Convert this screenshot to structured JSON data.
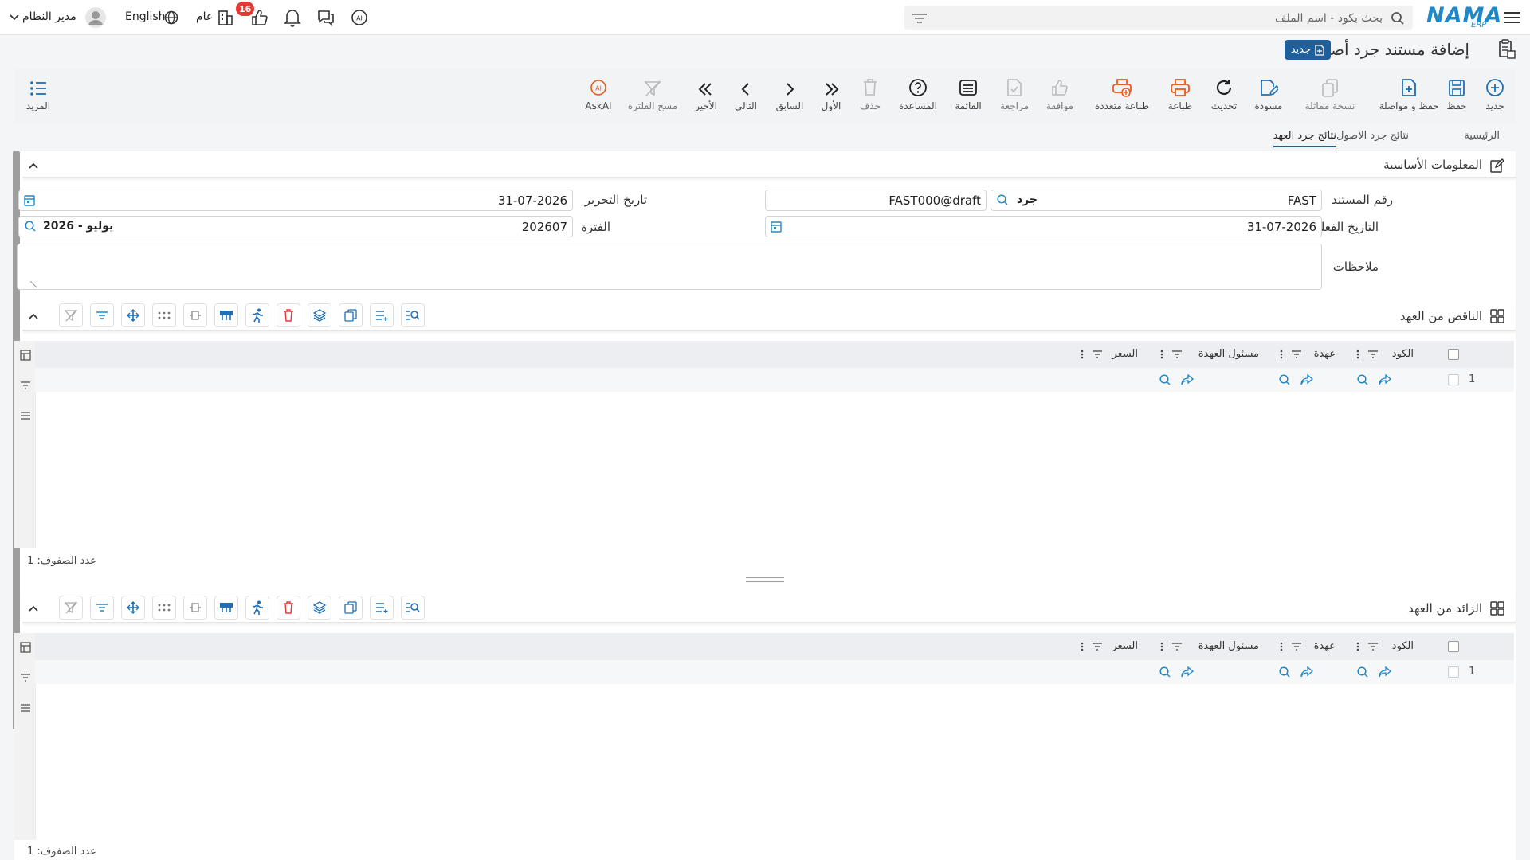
{
  "header": {
    "search_placeholder": "بحث بكود - اسم الملف",
    "logo_text": "NAMA",
    "logo_sub": "ERP",
    "notif_count": "16",
    "general_label": "عام",
    "language_label": "English",
    "user_label": "مدير النظام"
  },
  "page": {
    "title": "إضافة مستند جرد أصول",
    "status_badge": "جديد"
  },
  "toolbar": {
    "new": "جديد",
    "save": "حفظ",
    "save_continue": "حفظ و مواصلة",
    "duplicate": "نسخة مماثلة",
    "draft": "مسودة",
    "refresh": "تحديث",
    "print": "طباعة",
    "multi_print": "طباعة متعددة",
    "approve": "موافقة",
    "review": "مراجعة",
    "list": "القائمة",
    "help": "المساعدة",
    "delete": "حذف",
    "first": "الأول",
    "previous": "السابق",
    "next": "التالي",
    "last": "الأخير",
    "clear_filter": "مسح الفلترة",
    "askai": "AskAI",
    "more": "المزيد"
  },
  "tabs": [
    "الرئيسية",
    "نتائج جرد الاصول",
    "نتائج جرد العهد"
  ],
  "basic_info": {
    "section_title": "المعلومات الأساسية",
    "doc_number_label": "رقم المستند",
    "doc_number_value": "FAST",
    "doc_type_value": "جرد",
    "doc_code_value": "FAST000@draft",
    "edit_date_label": "تاريخ التحرير",
    "edit_date_value": "31-07-2026",
    "actual_date_label": "التاريخ الفعلي",
    "actual_date_value": "31-07-2026",
    "period_label": "الفترة",
    "period_value": "202607",
    "period_name": "2026 - يوليو",
    "notes_label": "ملاحظات"
  },
  "grid1": {
    "title": "الناقص من العهد",
    "columns": [
      "الكود",
      "عهدة",
      "مسئول العهدة",
      "السعر"
    ],
    "row_number": "1",
    "footer": "عدد الصفوف: 1"
  },
  "grid2": {
    "title": "الزائد من العهد",
    "columns": [
      "الكود",
      "عهدة",
      "مسئول العهدة",
      "السعر"
    ],
    "row_number": "1",
    "footer": "عدد الصفوف: 1"
  }
}
